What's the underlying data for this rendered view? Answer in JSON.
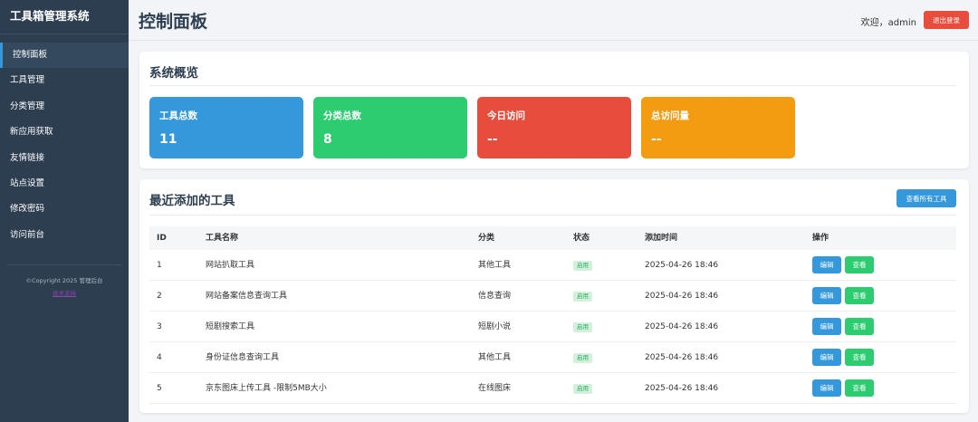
{
  "sidebar": {
    "brand": "工具箱管理系统",
    "items": [
      {
        "label": "控制面板"
      },
      {
        "label": "工具管理"
      },
      {
        "label": "分类管理"
      },
      {
        "label": "新应用获取"
      },
      {
        "label": "友情链接"
      },
      {
        "label": "站点设置"
      },
      {
        "label": "修改密码"
      },
      {
        "label": "访问前台"
      }
    ],
    "copyright": "©Copyright 2025 管理后台",
    "footer_link": "技术支持"
  },
  "header": {
    "title": "控制面板",
    "welcome": "欢迎，admin",
    "logout_label": "退出登录"
  },
  "overview": {
    "title": "系统概览",
    "stats": [
      {
        "label": "工具总数",
        "value": "11",
        "color": "#3498db"
      },
      {
        "label": "分类总数",
        "value": "8",
        "color": "#2ecc71"
      },
      {
        "label": "今日访问",
        "value": "--",
        "color": "#e74c3c"
      },
      {
        "label": "总访问量",
        "value": "--",
        "color": "#f39c12"
      }
    ]
  },
  "recent": {
    "title": "最近添加的工具",
    "view_all_label": "查看所有工具",
    "columns": {
      "id": "ID",
      "name": "工具名称",
      "category": "分类",
      "status": "状态",
      "added": "添加时间",
      "actions": "操作"
    },
    "rows": [
      {
        "id": "1",
        "name": "网站扒取工具",
        "category": "其他工具",
        "status": "启用",
        "added": "2025-04-26 18:46",
        "edit": "编辑",
        "view": "查看"
      },
      {
        "id": "2",
        "name": "网站备案信息查询工具",
        "category": "信息查询",
        "status": "启用",
        "added": "2025-04-26 18:46",
        "edit": "编辑",
        "view": "查看"
      },
      {
        "id": "3",
        "name": "短剧搜索工具",
        "category": "短剧小说",
        "status": "启用",
        "added": "2025-04-26 18:46",
        "edit": "编辑",
        "view": "查看"
      },
      {
        "id": "4",
        "name": "身份证信息查询工具",
        "category": "其他工具",
        "status": "启用",
        "added": "2025-04-26 18:46",
        "edit": "编辑",
        "view": "查看"
      },
      {
        "id": "5",
        "name": "京东图床上传工具 -限制5MB大小",
        "category": "在线图床",
        "status": "启用",
        "added": "2025-04-26 18:46",
        "edit": "编辑",
        "view": "查看"
      }
    ]
  }
}
